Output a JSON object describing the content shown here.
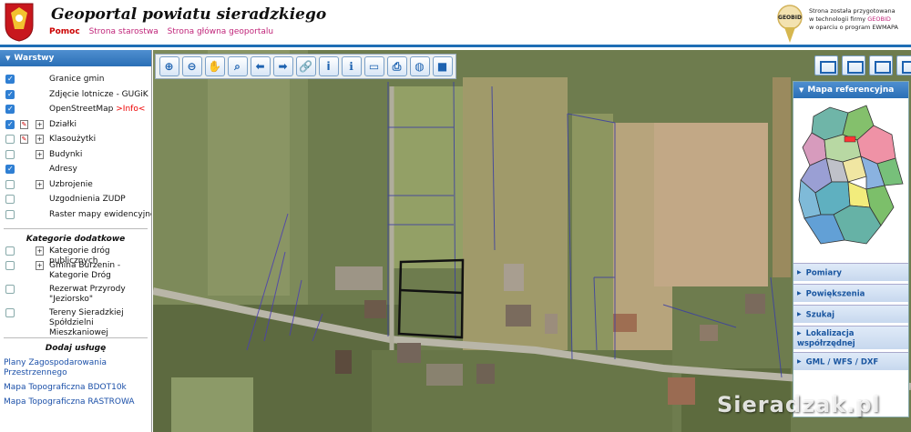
{
  "header": {
    "title": "Geoportal powiatu sieradzkiego",
    "links": [
      "Pomoc",
      "Strona starostwa",
      "Strona główna geoportalu"
    ],
    "geobid_logo_text": "GEOBID",
    "geobid_line1": "Strona została przygotowana",
    "geobid_line2_prefix": "w technologii firmy ",
    "geobid_line2_firm": "GEOBID",
    "geobid_line3": "w oparciu o program EWMAPA"
  },
  "sidebar": {
    "layers_title": "Warstwy",
    "layers": [
      {
        "label": "Granice gmin",
        "checked": true,
        "legend": false,
        "expand": false
      },
      {
        "label": "Zdjęcie lotnicze - GUGiK",
        "checked": true,
        "legend": false,
        "expand": false
      },
      {
        "label": "OpenStreetMap ",
        "info": ">Info<",
        "checked": true,
        "legend": false,
        "expand": false
      },
      {
        "label": "Działki",
        "checked": true,
        "legend": true,
        "expand": true
      },
      {
        "label": "Klasoużytki",
        "checked": false,
        "legend": true,
        "expand": true
      },
      {
        "label": "Budynki",
        "checked": false,
        "legend": false,
        "expand": true
      },
      {
        "label": "Adresy",
        "checked": true,
        "legend": false,
        "expand": false
      },
      {
        "label": "Uzbrojenie",
        "checked": false,
        "legend": false,
        "expand": true
      },
      {
        "label": "Uzgodnienia ZUDP",
        "checked": false,
        "legend": false,
        "expand": false
      },
      {
        "label": "Raster mapy ewidencyjnej",
        "checked": false,
        "legend": false,
        "expand": false
      }
    ],
    "extra_title": "Kategorie dodatkowe",
    "extra_layers": [
      {
        "label": "Kategorie dróg publicznych",
        "expand": true
      },
      {
        "label": "Gmina Burzenin - Kategorie Dróg",
        "expand": true
      },
      {
        "label": "Rezerwat Przyrody \"Jeziorsko\"",
        "expand": false
      },
      {
        "label": "Tereny Sieradzkiej Spółdzielni Mieszkaniowej",
        "expand": false
      }
    ],
    "services_title": "Dodaj usługę",
    "services": [
      "Plany Zagospodarowania Przestrzennego",
      "Mapa Topograficzna BDOT10k",
      "Mapa Topograficzna RASTROWA"
    ]
  },
  "toolbar": {
    "tools": [
      {
        "icon": "zoom-in-icon",
        "glyph": "⊕"
      },
      {
        "icon": "zoom-out-icon",
        "glyph": "⊖"
      },
      {
        "icon": "pan-hand-icon",
        "glyph": "✋"
      },
      {
        "icon": "zoom-window-icon",
        "glyph": "⌕"
      },
      {
        "icon": "arrow-back-icon",
        "glyph": "⬅"
      },
      {
        "icon": "arrow-forward-icon",
        "glyph": "➡"
      },
      {
        "icon": "link-icon",
        "glyph": "🔗"
      },
      {
        "icon": "info-icon",
        "glyph": "i"
      },
      {
        "icon": "identify-icon",
        "glyph": "ℹ"
      },
      {
        "icon": "measure-icon",
        "glyph": "▭"
      },
      {
        "icon": "print-icon",
        "glyph": "⎙"
      },
      {
        "icon": "globe-icon",
        "glyph": "◍"
      },
      {
        "icon": "video-icon",
        "glyph": "■"
      }
    ]
  },
  "reference": {
    "title": "Mapa referencyjna",
    "accordion": [
      "Pomiary",
      "Powiększenia",
      "Szukaj",
      "Lokalizacja współrzędnej",
      "GML / WFS / DXF"
    ]
  },
  "watermark": "Sieradzak.pl",
  "colors": {
    "header_bar": "#1e6eb5",
    "accent_link": "#c0267a",
    "panel_blue": "#2a6fb6"
  }
}
